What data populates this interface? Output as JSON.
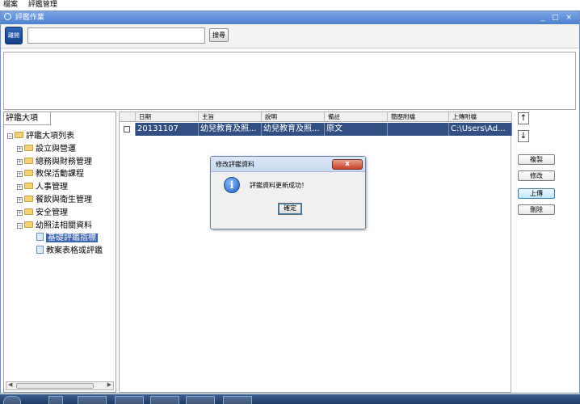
{
  "menubar": {
    "items": [
      "檔案",
      "評鑑管理"
    ]
  },
  "window": {
    "title": "評鑑作業",
    "controls": "_ □ ×"
  },
  "toolbar": {
    "exit_label": "離開",
    "search_value": "",
    "search_button": "搜尋"
  },
  "left_panel": {
    "tab_label": "評鑑大項",
    "tree": {
      "root": "評鑑大項列表",
      "items": [
        "設立與營運",
        "總務與財務管理",
        "教保活動課程",
        "人事管理",
        "餐飲與衛生管理",
        "安全管理",
        "幼照法相關資料"
      ],
      "children": [
        "基礎評鑑指標",
        "教案表格或評鑑"
      ]
    }
  },
  "grid": {
    "columns": [
      "日期",
      "主旨",
      "說明",
      "備註",
      "簡歷附檔",
      "上傳附檔"
    ],
    "rows": [
      [
        "20131107",
        "幼兒教育及照...",
        "幼兒教育及照...",
        "原文",
        "",
        "C:\\Users\\Ad..."
      ]
    ]
  },
  "side_buttons": {
    "up": "↑",
    "down": "↓",
    "copy": "複製",
    "edit": "修改",
    "upload": "上傳",
    "delete": "刪除"
  },
  "dialog": {
    "title": "修改評鑑資料",
    "message": "評鑑資料更新成功！",
    "ok": "確定",
    "close": "x"
  }
}
